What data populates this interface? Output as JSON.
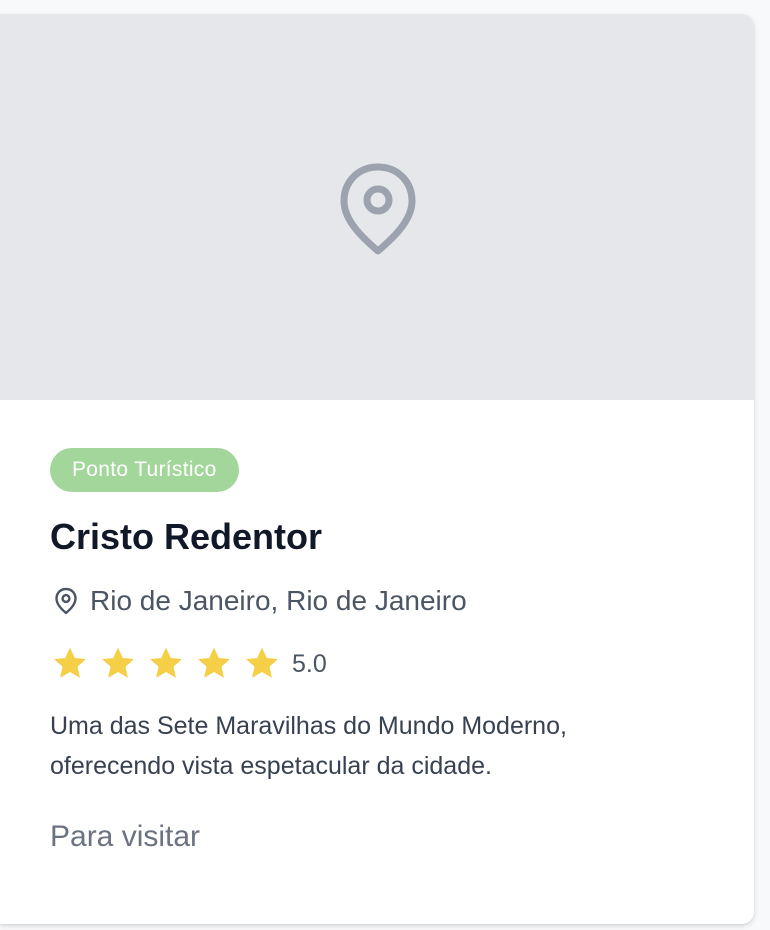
{
  "card": {
    "image_icon": "map-pin-icon",
    "category": "Ponto Turístico",
    "title": "Cristo Redentor",
    "location_icon": "map-pin-icon",
    "location": "Rio de Janeiro, Rio de Janeiro",
    "rating": {
      "stars": 5,
      "max_stars": 5,
      "score": "5.0",
      "star_color": "#f5cf48"
    },
    "description": "Uma das Sete Maravilhas do Mundo Moderno, oferecendo vista espetacular da cidade.",
    "status": "Para visitar",
    "colors": {
      "badge_bg": "#a3d69a",
      "placeholder_bg": "#e5e7eb",
      "placeholder_icon": "#9ca3af"
    }
  }
}
